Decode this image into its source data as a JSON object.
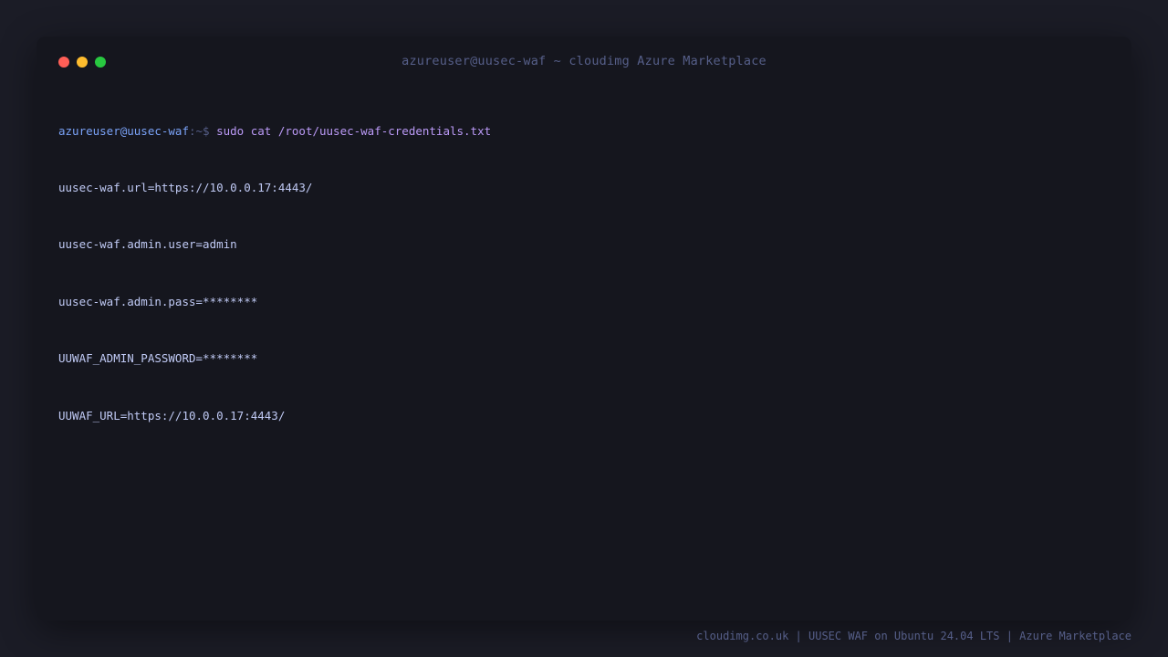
{
  "window": {
    "title": "azureuser@uusec-waf ~ cloudimg Azure Marketplace"
  },
  "terminal": {
    "prompt_user": "azureuser@uusec-waf",
    "prompt_sep": ":~$",
    "command": "sudo cat /root/uusec-waf-credentials.txt",
    "output": [
      "uusec-waf.url=https://10.0.0.17:4443/",
      "uusec-waf.admin.user=admin",
      "uusec-waf.admin.pass=********",
      "UUWAF_ADMIN_PASSWORD=********",
      "UUWAF_URL=https://10.0.0.17:4443/"
    ]
  },
  "footer": {
    "text": "cloudimg.co.uk | UUSEC WAF on Ubuntu 24.04 LTS | Azure Marketplace"
  },
  "colors": {
    "background": "#1b1c26",
    "window": "#15161e",
    "prompt": "#7aa2f7",
    "command": "#bb9af7",
    "output": "#c0caf5",
    "muted": "#565f89",
    "close": "#ff5f57",
    "minimize": "#febc2e",
    "maximize": "#28c840"
  }
}
